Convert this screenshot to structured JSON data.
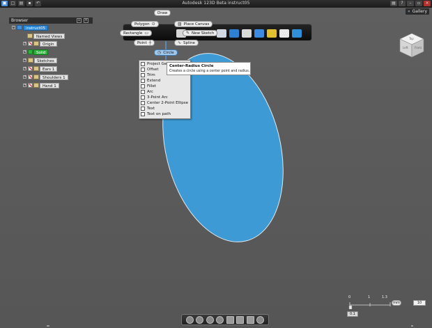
{
  "app": {
    "title": "Autodesk 123D Beta   instruct05"
  },
  "gallery": {
    "label": "Gallery",
    "chevron": "«"
  },
  "browser": {
    "title": "Browser",
    "items": [
      {
        "label": "instruct05"
      },
      {
        "label": "Named Views"
      },
      {
        "label": "Origin"
      },
      {
        "label": "Solid"
      },
      {
        "label": "Sketches"
      },
      {
        "label": "Ears 1"
      },
      {
        "label": "Shoulders 1"
      },
      {
        "label": "Hand 1"
      }
    ]
  },
  "toolbar": {
    "draw": "Draw",
    "polygon": "Polygon",
    "rectangle": "Rectangle",
    "point": "Point",
    "place_canvas": "Place Canvas",
    "new_sketch": "New Sketch",
    "spline": "Spline",
    "circle": "Circle",
    "accent_color": "#2a86d6"
  },
  "menu": {
    "items": [
      "Project Geometry",
      "Offset",
      "Trim",
      "Extend",
      "Fillet",
      "Arc",
      "3-Point Arc",
      "Center 2-Point Ellipse",
      "Text",
      "Text on path"
    ]
  },
  "tooltip": {
    "title": "Center-Radius Circle",
    "description": "Creates a circle using a center point and radius."
  },
  "viewcube": {
    "top": "Top",
    "left": "Left",
    "right": "Front"
  },
  "scale": {
    "unit": "mm",
    "value": "10",
    "sub_value": "0.1",
    "tick_0": "0",
    "tick_mid": "1",
    "tick_end": "1.3"
  },
  "model": {
    "fill": "#3d9ad4"
  }
}
